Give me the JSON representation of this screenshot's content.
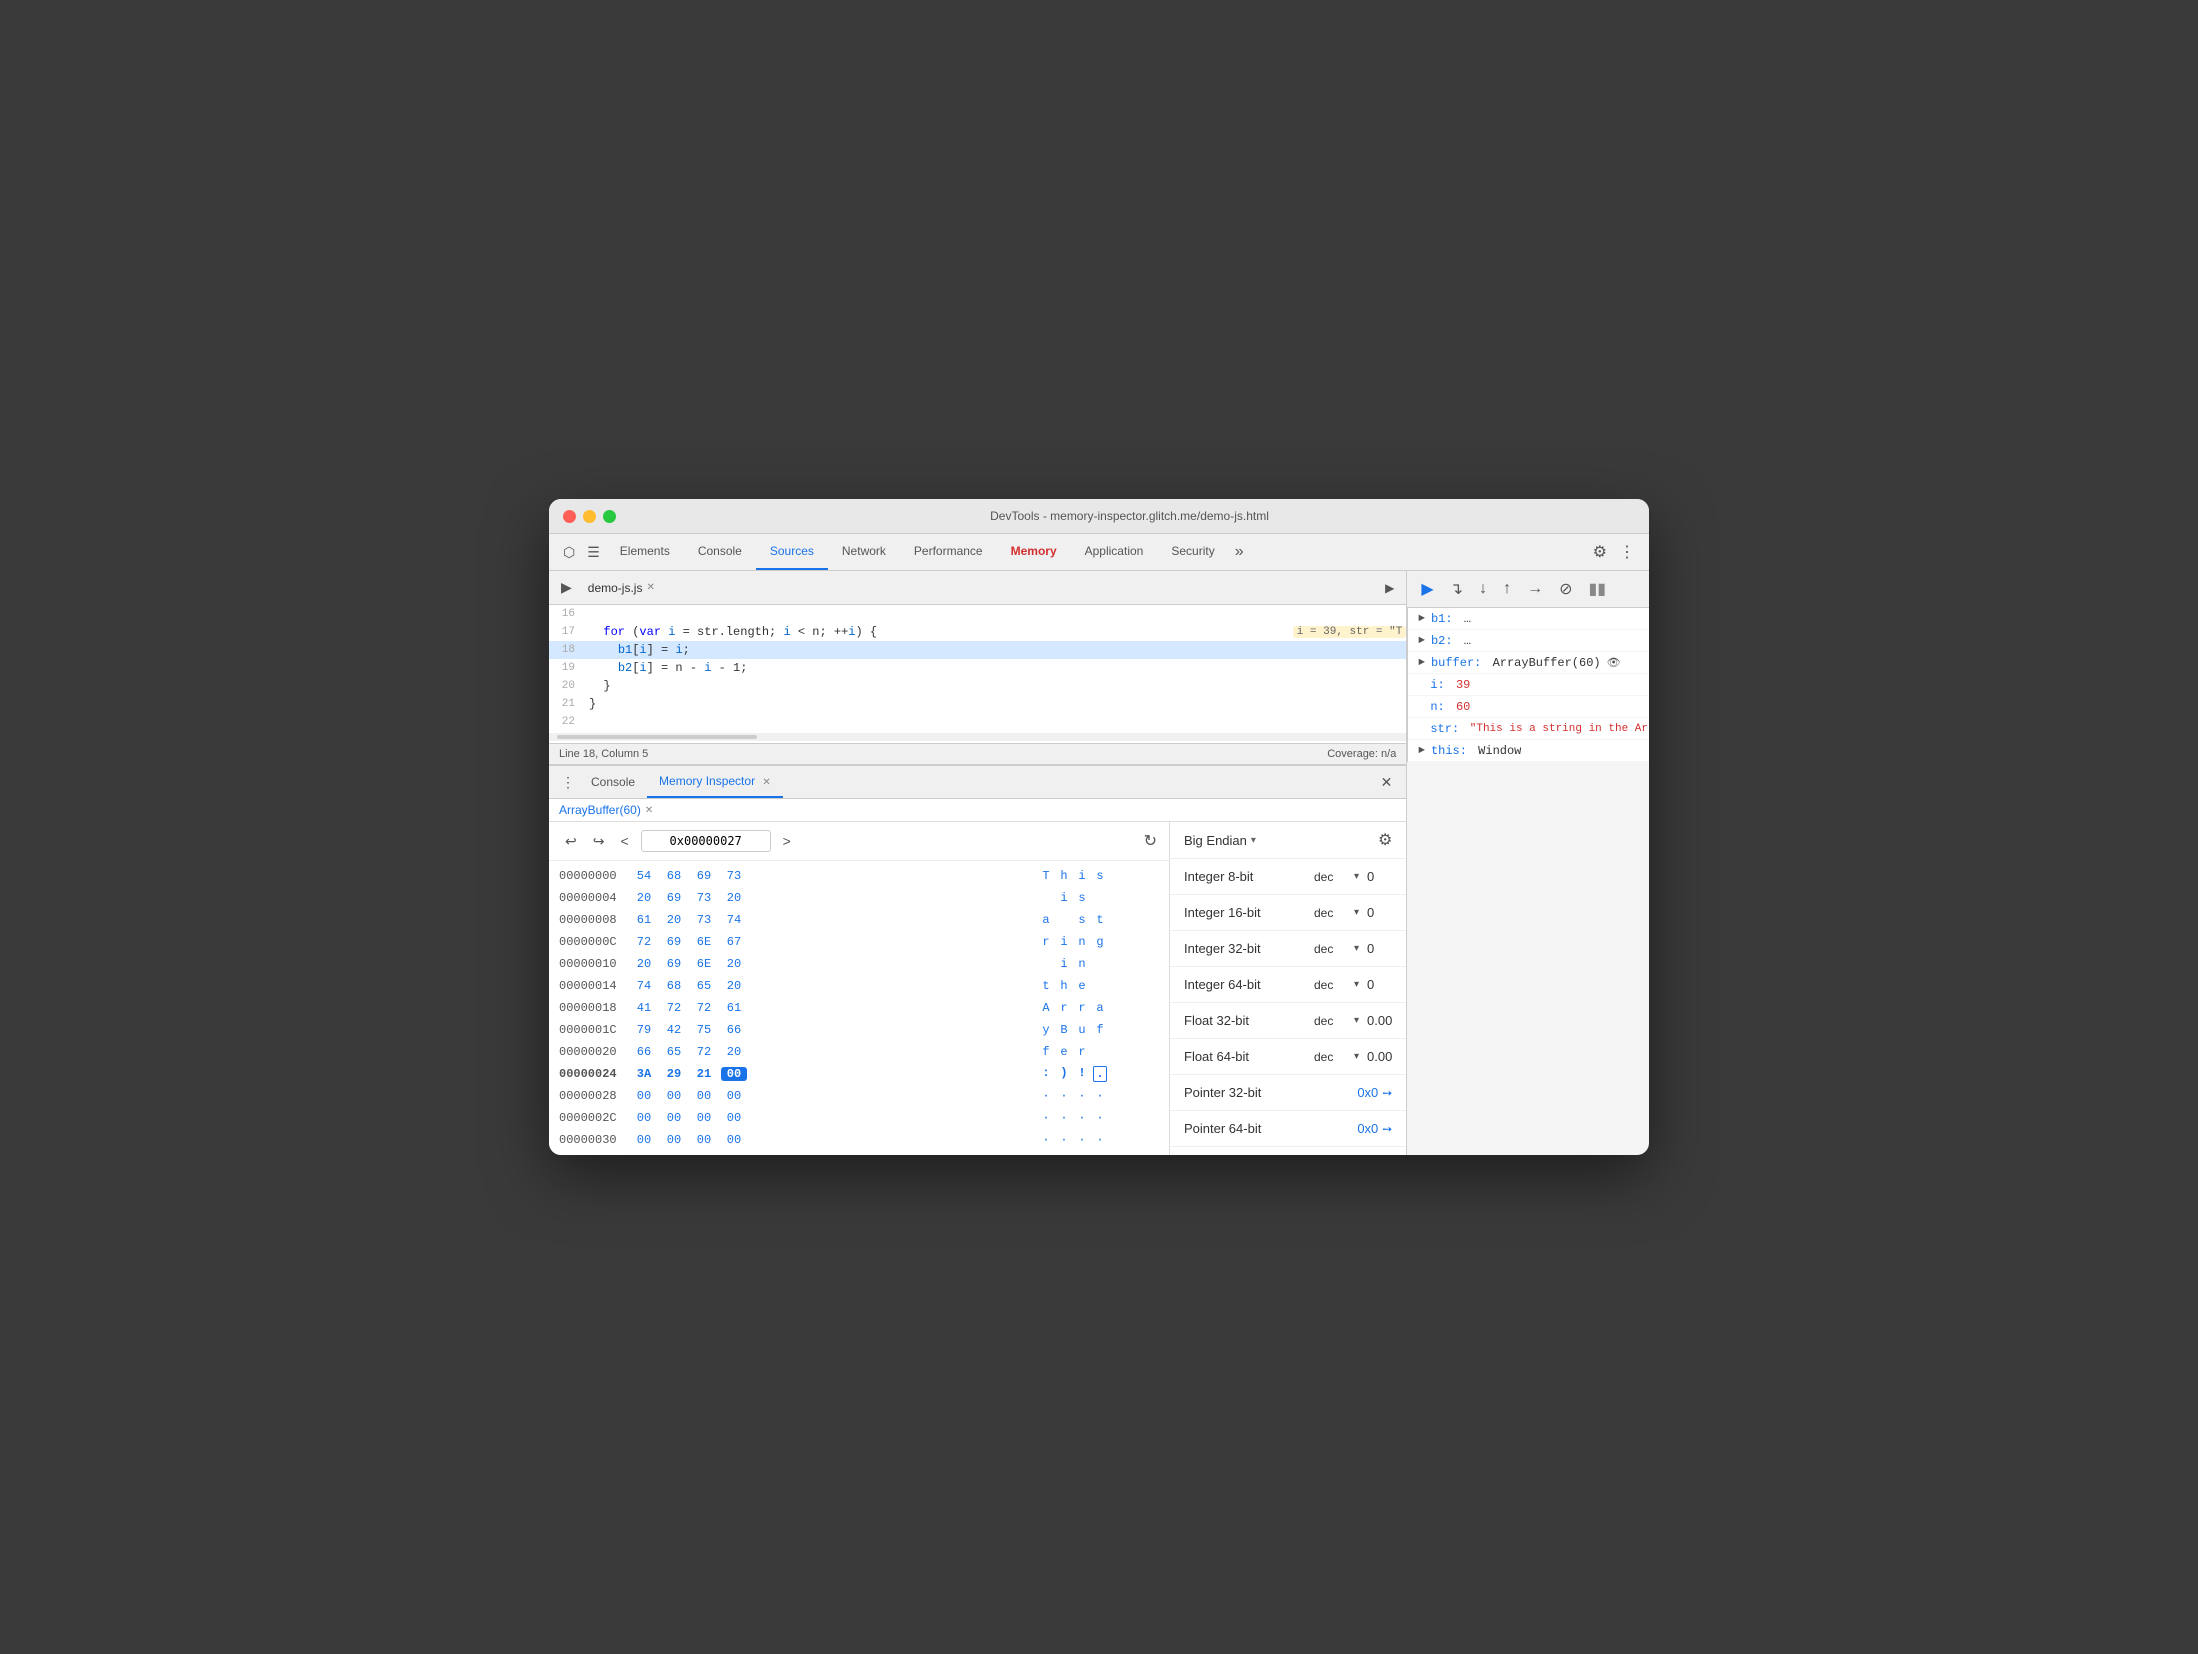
{
  "window": {
    "title": "DevTools - memory-inspector.glitch.me/demo-js.html"
  },
  "devtools_tabs": {
    "tabs": [
      "Elements",
      "Console",
      "Sources",
      "Network",
      "Performance",
      "Memory",
      "Application",
      "Security"
    ],
    "active": "Sources"
  },
  "source_file": {
    "name": "demo-js.js",
    "status_left": "Line 18, Column 5",
    "status_right": "Coverage: n/a"
  },
  "code_lines": [
    {
      "num": "16",
      "content": ""
    },
    {
      "num": "17",
      "content": "  for (var i = str.length; i < n; ++i) {",
      "inline_dbg": "i = 39, str = \"T"
    },
    {
      "num": "18",
      "content": "    b1[i] = i;",
      "highlighted": true
    },
    {
      "num": "19",
      "content": "    b2[i] = n - i - 1;"
    },
    {
      "num": "20",
      "content": "  }"
    },
    {
      "num": "21",
      "content": "}"
    },
    {
      "num": "22",
      "content": ""
    }
  ],
  "bottom_panel": {
    "tabs": [
      "Console",
      "Memory Inspector"
    ],
    "active": "Memory Inspector",
    "close_visible": true
  },
  "array_buffer_tab": "ArrayBuffer(60)",
  "hex_nav": {
    "address": "0x00000027",
    "back_label": "←",
    "forward_label": "→",
    "undo_label": "↩",
    "redo_label": "↪"
  },
  "hex_rows": [
    {
      "addr": "00000000",
      "bytes": [
        "54",
        "68",
        "69",
        "73"
      ],
      "chars": [
        "T",
        "h",
        "i",
        "s"
      ],
      "active": false
    },
    {
      "addr": "00000004",
      "bytes": [
        "20",
        "69",
        "73",
        "20"
      ],
      "chars": [
        " ",
        "i",
        "s",
        " "
      ],
      "active": false
    },
    {
      "addr": "00000008",
      "bytes": [
        "61",
        "20",
        "73",
        "74"
      ],
      "chars": [
        "a",
        " ",
        "s",
        "t"
      ],
      "active": false
    },
    {
      "addr": "0000000C",
      "bytes": [
        "72",
        "69",
        "6E",
        "67"
      ],
      "chars": [
        "r",
        "i",
        "n",
        "g"
      ],
      "active": false
    },
    {
      "addr": "00000010",
      "bytes": [
        "20",
        "69",
        "6E",
        "20"
      ],
      "chars": [
        " ",
        "i",
        "n",
        " "
      ],
      "active": false
    },
    {
      "addr": "00000014",
      "bytes": [
        "74",
        "68",
        "65",
        "20"
      ],
      "chars": [
        "t",
        "h",
        "e",
        " "
      ],
      "active": false
    },
    {
      "addr": "00000018",
      "bytes": [
        "41",
        "72",
        "72",
        "61"
      ],
      "chars": [
        "A",
        "r",
        "r",
        "a"
      ],
      "active": false
    },
    {
      "addr": "0000001C",
      "bytes": [
        "79",
        "42",
        "75",
        "66"
      ],
      "chars": [
        "y",
        "B",
        "u",
        "f"
      ],
      "active": false
    },
    {
      "addr": "00000020",
      "bytes": [
        "66",
        "65",
        "72",
        "20"
      ],
      "chars": [
        "f",
        "e",
        "r",
        " "
      ],
      "active": false
    },
    {
      "addr": "00000024",
      "bytes": [
        "3A",
        "29",
        "21",
        "00"
      ],
      "chars": [
        ":",
        ")",
        " ",
        "·"
      ],
      "active": true,
      "selected_byte": 3
    },
    {
      "addr": "00000028",
      "bytes": [
        "00",
        "00",
        "00",
        "00"
      ],
      "chars": [
        "·",
        "·",
        "·",
        "·"
      ],
      "active": false
    },
    {
      "addr": "0000002C",
      "bytes": [
        "00",
        "00",
        "00",
        "00"
      ],
      "chars": [
        "·",
        "·",
        "·",
        "·"
      ],
      "active": false
    },
    {
      "addr": "00000030",
      "bytes": [
        "00",
        "00",
        "00",
        "00"
      ],
      "chars": [
        "·",
        "·",
        "·",
        "·"
      ],
      "active": false
    }
  ],
  "endian": {
    "label": "Big Endian",
    "arrow": "▾"
  },
  "value_rows": [
    {
      "label": "Integer 8-bit",
      "type": "dec",
      "value": "0"
    },
    {
      "label": "Integer 16-bit",
      "type": "dec",
      "value": "0"
    },
    {
      "label": "Integer 32-bit",
      "type": "dec",
      "value": "0"
    },
    {
      "label": "Integer 64-bit",
      "type": "dec",
      "value": "0"
    },
    {
      "label": "Float 32-bit",
      "type": "dec",
      "value": "0.00"
    },
    {
      "label": "Float 64-bit",
      "type": "dec",
      "value": "0.00"
    },
    {
      "label": "Pointer 32-bit",
      "type": "",
      "value": "0x0"
    },
    {
      "label": "Pointer 64-bit",
      "type": "",
      "value": "0x0"
    }
  ],
  "scope": [
    {
      "key": "b1:",
      "val": "…",
      "arrow": true
    },
    {
      "key": "b2:",
      "val": "…",
      "arrow": true
    },
    {
      "key": "buffer:",
      "val": "ArrayBuffer(60)",
      "has_icon": true,
      "arrow": true
    },
    {
      "key": "i:",
      "val": "39",
      "arrow": false
    },
    {
      "key": "n:",
      "val": "60",
      "arrow": false
    },
    {
      "key": "str:",
      "val": "\"This is a string in the ArrayBuffer :)!\"",
      "arrow": false
    },
    {
      "key": "this:",
      "val": "Window",
      "arrow": true
    }
  ],
  "debugger_toolbar": {
    "resume": "▶",
    "step_over": "⤵",
    "step_into": "↓",
    "step_out": "↑",
    "step": "→",
    "deactivate": "⊘",
    "pause": "⏸"
  }
}
